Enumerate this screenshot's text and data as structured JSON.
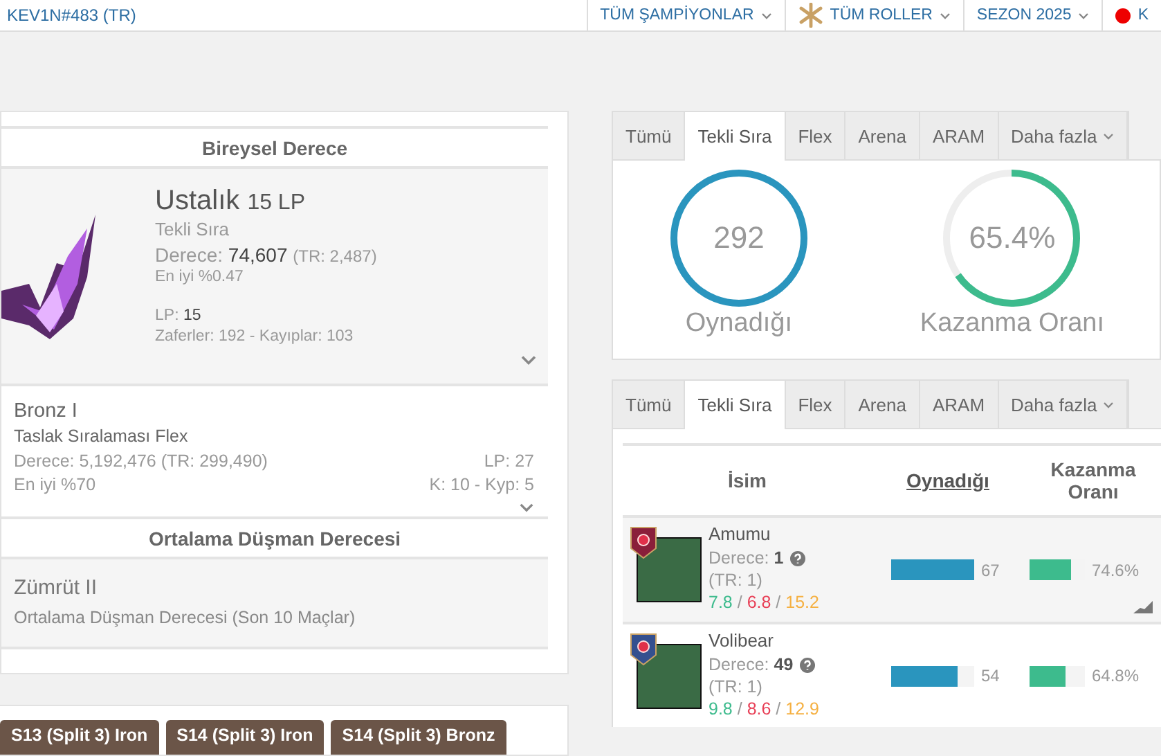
{
  "header": {
    "player": "KEV1N#483 (TR)",
    "filters": [
      {
        "label": "TÜM ŞAMPİYONLAR",
        "kind": "dropdown"
      },
      {
        "label": "TÜM ROLLER",
        "kind": "roles"
      },
      {
        "label": "SEZON 2025",
        "kind": "dropdown"
      },
      {
        "label": "K",
        "kind": "status"
      }
    ]
  },
  "solo_rank": {
    "title": "Bireysel Derece",
    "tier": "Ustalık",
    "lp": "15 LP",
    "queue": "Tekli Sıra",
    "rank_label": "Derece:",
    "rank": "74,607",
    "region_rank": "(TR: 2,487)",
    "top_percent": "En iyi %0.47",
    "lp_label": "LP:",
    "lp_value": "15",
    "record": "Zaferler: 192 - Kayıplar: 103"
  },
  "flex_rank": {
    "tier": "Bronz I",
    "queue": "Taslak Sıralaması Flex",
    "rank": "Derece: 5,192,476 (TR: 299,490)",
    "top_percent": "En iyi %70",
    "lp": "LP: 27",
    "record": "K: 10 - Kyp: 5"
  },
  "enemy_rank": {
    "title": "Ortalama Düşman Derecesi",
    "tier": "Zümrüt II",
    "description": "Ortalama Düşman Derecesi (Son 10 Maçlar)"
  },
  "season_tags": [
    "S13 (Split 3) Iron",
    "S14 (Split 3) Iron",
    "S14 (Split 3) Bronz"
  ],
  "stats_tabs": [
    {
      "label": "Tümü",
      "selected": false
    },
    {
      "label": "Tekli Sıra",
      "selected": true
    },
    {
      "label": "Flex",
      "selected": false
    },
    {
      "label": "Arena",
      "selected": false
    },
    {
      "label": "ARAM",
      "selected": false
    },
    {
      "label": "Daha fazla",
      "selected": false,
      "kind": "dropdown"
    }
  ],
  "stats": {
    "played": "292",
    "played_label": "Oynadığı",
    "win_rate": {
      "value": "65.4%"
    },
    "win_label": "Kazanma Oranı"
  },
  "champion_tabs": [
    {
      "label": "Tümü",
      "selected": false
    },
    {
      "label": "Tekli Sıra",
      "selected": true
    },
    {
      "label": "Flex",
      "selected": false
    },
    {
      "label": "Arena",
      "selected": false
    },
    {
      "label": "ARAM",
      "selected": false
    },
    {
      "label": "Daha fazla",
      "selected": false,
      "kind": "dropdown"
    }
  ],
  "champion_table": {
    "columns": [
      {
        "label": "İsim",
        "sorted": false
      },
      {
        "label": "Oynadığı",
        "sorted": true
      },
      {
        "label": "Kazanma Oranı",
        "sorted": false
      }
    ],
    "rows": [
      {
        "name": "Amumu",
        "rank_label": "Derece:",
        "rank": "1",
        "region_rank": "(TR: 1)",
        "kills": "7.8",
        "deaths": "6.8",
        "assists": "15.2",
        "separator": "/",
        "played": {
          "value": "67",
          "level": 1.0
        },
        "win_rate": {
          "value": "74.6%",
          "level": 0.746
        },
        "color": "#8a1f3a",
        "selected": true
      },
      {
        "name": "Volibear",
        "rank_label": "Derece:",
        "rank": "49",
        "region_rank": "(TR: 1)",
        "kills": "9.8",
        "deaths": "8.6",
        "assists": "12.9",
        "separator": "/",
        "played": {
          "value": "54",
          "level": 0.8
        },
        "win_rate": {
          "value": "64.8%",
          "level": 0.648
        },
        "color": "#34508f",
        "selected": false
      }
    ]
  }
}
